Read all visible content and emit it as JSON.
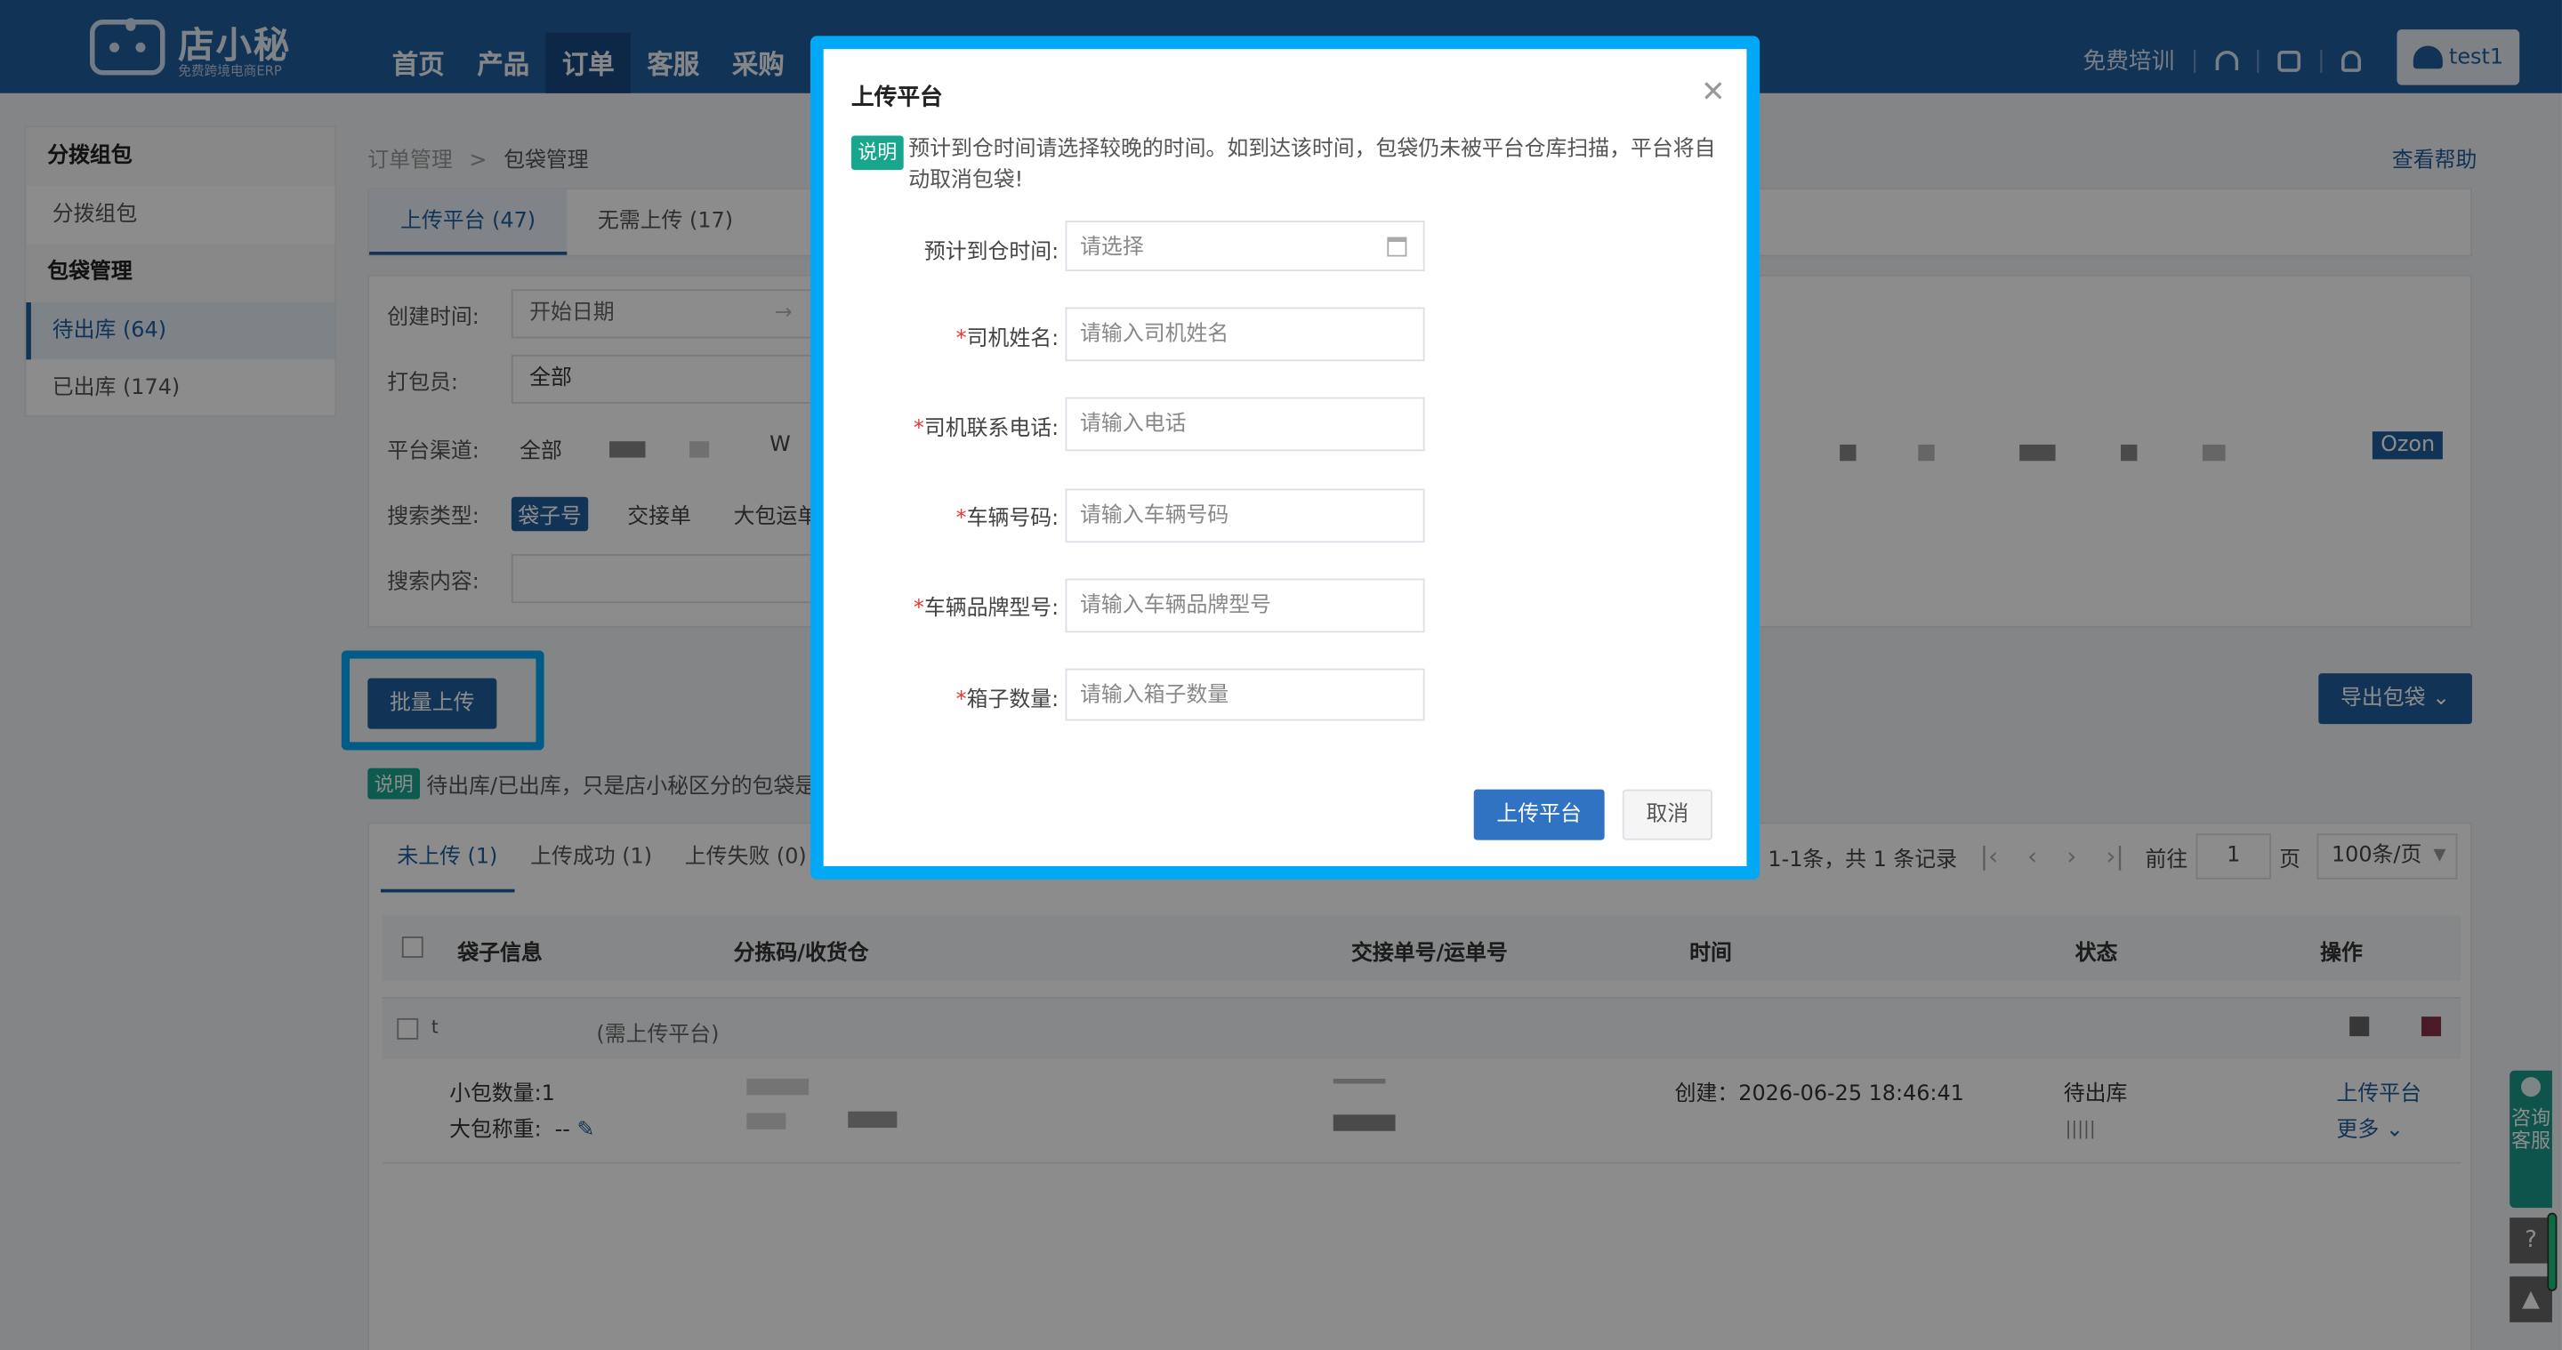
{
  "app": {
    "logo_name": "店小秘",
    "logo_sub": "免费跨境电商ERP",
    "nav": [
      "首页",
      "产品",
      "订单",
      "客服",
      "采购"
    ],
    "free_training": "免费培训",
    "username": "test1"
  },
  "sidebar": {
    "groups": [
      {
        "title": "分拨组包",
        "items": [
          "分拨组包"
        ]
      },
      {
        "title": "包袋管理",
        "items": [
          "待出库 (64)",
          "已出库 (174)"
        ]
      }
    ]
  },
  "breadcrumb": {
    "root": "订单管理",
    "sep": ">",
    "current": "包袋管理"
  },
  "help_link": "查看帮助",
  "tabs": [
    "上传平台 (47)",
    "无需上传 (17)"
  ],
  "filters": {
    "created_label": "创建时间:",
    "start_date_placeholder": "开始日期",
    "range_arrow": "→",
    "packer_label": "打包员:",
    "packer_value": "全部",
    "channel_label": "平台渠道:",
    "channel_all": "全部",
    "channel_partial": "W",
    "channel_ozon": "Ozon",
    "search_type_label": "搜索类型:",
    "search_types": [
      "袋子号",
      "交接单",
      "大包运单"
    ],
    "search_content_label": "搜索内容:"
  },
  "actions": {
    "batch_upload": "批量上传",
    "export_bags": "导出包袋",
    "note_tag": "说明",
    "note_text": "待出库/已出库，只是店小秘区分的包袋是否"
  },
  "list": {
    "tabs": [
      "未上传 (1)",
      "上传成功 (1)",
      "上传失败 (0)"
    ],
    "pagination": {
      "summary": "1-1条，共 1 条记录",
      "goto": "前往",
      "page": "1",
      "page_unit": "页",
      "page_size": "100条/页"
    },
    "columns": [
      "袋子信息",
      "分拣码/收货仓",
      "交接单号/运单号",
      "时间",
      "状态",
      "操作"
    ],
    "group_row": {
      "bag_no": "t",
      "note": "(需上传平台)"
    },
    "row": {
      "small_count": "小包数量:1",
      "weight_label": "大包称重:",
      "weight_value": "--",
      "created": "创建：2026-06-25 18:46:41",
      "status": "待出库",
      "op_upload": "上传平台",
      "op_more": "更多"
    }
  },
  "float": {
    "consult": "咨询客服",
    "help": "?",
    "top": "▲"
  },
  "modal": {
    "title": "上传平台",
    "note_tag": "说明",
    "note_text": "预计到仓时间请选择较晚的时间。如到达该时间，包袋仍未被平台仓库扫描，平台将自动取消包袋!",
    "fields": [
      {
        "label": "预计到仓时间:",
        "required": false,
        "placeholder": "请选择"
      },
      {
        "label": "司机姓名:",
        "required": true,
        "placeholder": "请输入司机姓名"
      },
      {
        "label": "司机联系电话:",
        "required": true,
        "placeholder": "请输入电话"
      },
      {
        "label": "车辆号码:",
        "required": true,
        "placeholder": "请输入车辆号码"
      },
      {
        "label": "车辆品牌型号:",
        "required": true,
        "placeholder": "请输入车辆品牌型号"
      },
      {
        "label": "箱子数量:",
        "required": true,
        "placeholder": "请输入箱子数量"
      }
    ],
    "confirm": "上传平台",
    "cancel": "取消"
  }
}
